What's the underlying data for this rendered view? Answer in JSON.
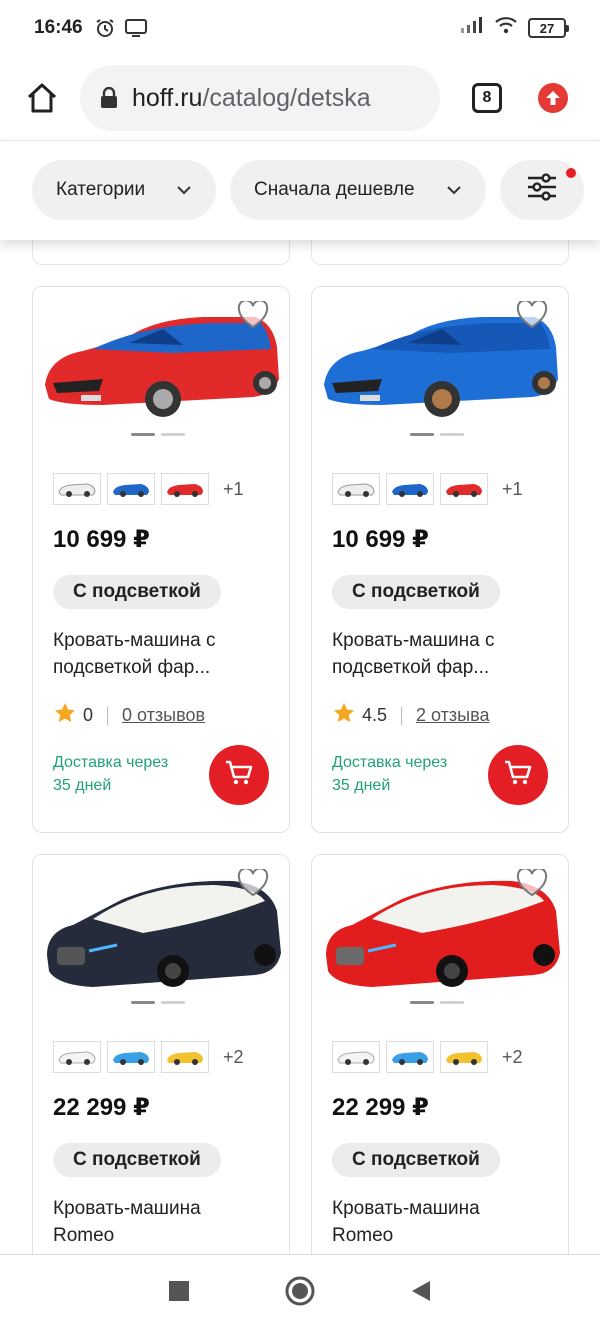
{
  "status": {
    "time": "16:46",
    "battery": "27",
    "icons": [
      "alarm-icon",
      "screen-cast-icon",
      "signal-icon",
      "wifi-icon",
      "battery-icon"
    ]
  },
  "browser": {
    "url_host": "hoff.ru",
    "url_path": "/catalog/detska",
    "tab_count": "8",
    "icons": [
      "home-icon",
      "lock-icon",
      "tabs-icon",
      "update-icon"
    ]
  },
  "filters": {
    "category_label": "Категории",
    "sort_label": "Сначала дешевле",
    "filter_icon": "sliders-icon",
    "filter_active_color": "#e31e24"
  },
  "colors": {
    "brand_red": "#e31e24",
    "delivery_green": "#21a17a",
    "star": "#f5a623"
  },
  "products": [
    {
      "image": "red-blue-race-car-bed",
      "thumbs": [
        "white-car",
        "blue-car",
        "red-car"
      ],
      "more": "+1",
      "price": "10 699 ₽",
      "badge": "С подсветкой",
      "title_line1": "Кровать-машина с",
      "title_line2": "подсветкой фар...",
      "rating": "0",
      "reviews": "0 отзывов",
      "delivery_line1": "Доставка через",
      "delivery_line2": "35 дней"
    },
    {
      "image": "blue-race-car-bed",
      "thumbs": [
        "white-car",
        "blue-car",
        "red-car"
      ],
      "more": "+1",
      "price": "10 699 ₽",
      "badge": "С подсветкой",
      "title_line1": "Кровать-машина с",
      "title_line2": "подсветкой фар...",
      "rating": "4.5",
      "reviews": "2 отзыва",
      "delivery_line1": "Доставка через",
      "delivery_line2": "35 дней"
    },
    {
      "image": "black-romeo-car-bed",
      "thumbs": [
        "white-car",
        "blue-car",
        "yellow-car"
      ],
      "more": "+2",
      "price": "22 299 ₽",
      "badge": "С подсветкой",
      "title_line1": "Кровать-машина",
      "title_line2": "Romeo"
    },
    {
      "image": "red-romeo-car-bed",
      "thumbs": [
        "white-car",
        "blue-car",
        "yellow-car"
      ],
      "more": "+2",
      "price": "22 299 ₽",
      "badge": "С подсветкой",
      "title_line1": "Кровать-машина",
      "title_line2": "Romeo"
    }
  ],
  "navbar": {
    "icons": [
      "recents-square-icon",
      "home-circle-icon",
      "back-triangle-icon"
    ]
  }
}
